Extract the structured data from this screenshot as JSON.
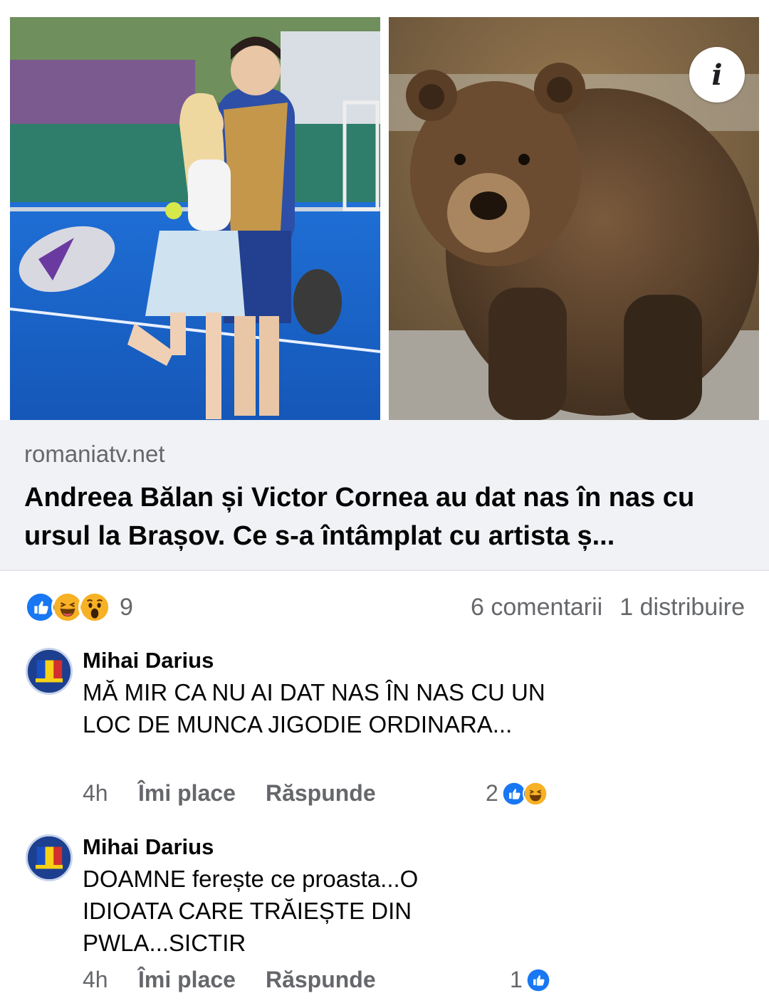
{
  "link": {
    "domain": "romaniatv.net",
    "title": "Andreea Bălan și Victor Cornea au dat nas în nas cu ursul la Brașov. Ce s-a întâmplat cu artista ș..."
  },
  "images": {
    "info_icon": "i"
  },
  "reactions": {
    "icons": [
      "like-icon",
      "haha-icon",
      "wow-icon"
    ],
    "count": "9",
    "comments_label": "6 comentarii",
    "shares_label": "1 distribuire"
  },
  "comments": [
    {
      "author": "Mihai Darius",
      "text": "MĂ MIR CA NU AI DAT NAS ÎN NAS CU UN LOC DE MUNCA JIGODIE ORDINARA...",
      "time": "4h",
      "like_label": "Îmi place",
      "reply_label": "Răspunde",
      "reaction_count": "2",
      "reaction_icons": [
        "like-icon",
        "haha-icon"
      ]
    },
    {
      "author": "Mihai Darius",
      "text": "DOAMNE ferește ce proasta...O IDIOATA CARE TRĂIEȘTE DIN PWLA...SICTIR",
      "time": "4h",
      "like_label": "Îmi place",
      "reply_label": "Răspunde",
      "reaction_count": "1",
      "reaction_icons": [
        "like-icon"
      ]
    }
  ],
  "colors": {
    "like_blue": "#1877f2",
    "emoji_yellow": "#f7b125",
    "secondary_text": "#65676b",
    "link_bg": "#f0f2f5"
  }
}
